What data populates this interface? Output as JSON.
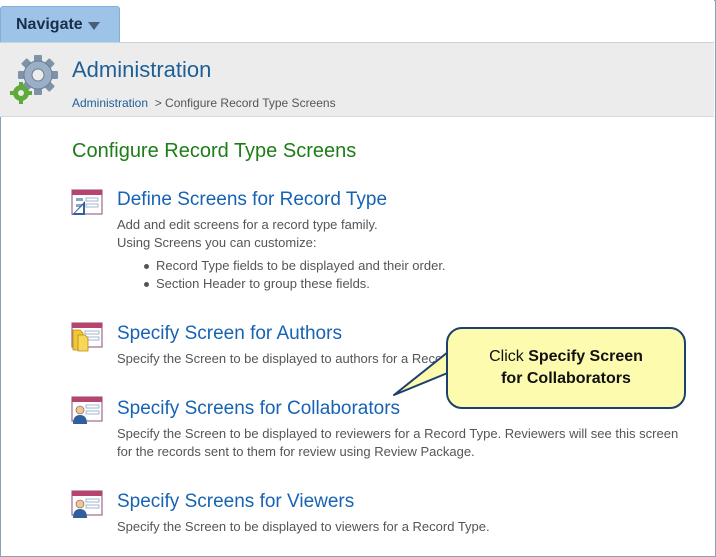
{
  "nav": {
    "label": "Navigate"
  },
  "header": {
    "title": "Administration",
    "breadcrumb_link": "Administration",
    "breadcrumb_current": "> Configure Record Type Screens"
  },
  "page": {
    "title": "Configure Record Type Screens"
  },
  "sections": [
    {
      "heading": "Define Screens for Record Type",
      "desc_lines": [
        "Add and edit screens for a record type family.",
        "Using Screens you can customize:"
      ],
      "bullets": [
        "Record Type fields to be displayed and their order.",
        "Section Header to group these fields."
      ]
    },
    {
      "heading": "Specify Screen for Authors",
      "desc_lines": [
        "Specify the Screen to be displayed to authors for a Reco"
      ]
    },
    {
      "heading": "Specify Screens for Collaborators",
      "desc_lines": [
        "Specify the Screen to be displayed to reviewers for a Record Type. Reviewers will see this screen",
        "for the records sent to them for review using Review Package."
      ]
    },
    {
      "heading": "Specify Screens for Viewers",
      "desc_lines": [
        "Specify the Screen to be displayed to viewers for a Record Type."
      ]
    }
  ],
  "callout": {
    "prefix": "Click ",
    "bold_line1": "Specify Screen",
    "bold_line2": "for Collaborators"
  },
  "colors": {
    "accent": "#1763b3",
    "title_green": "#1e7d18",
    "callout_bg": "#fdfbae"
  },
  "icons": [
    "gear-icon",
    "screen-form-icon",
    "authors-icon",
    "collaborator-icon",
    "viewer-icon",
    "chevron-down-icon"
  ]
}
